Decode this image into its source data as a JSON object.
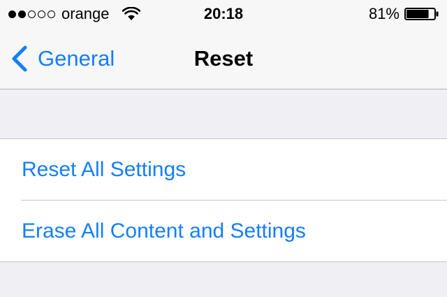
{
  "status_bar": {
    "signal_bars_filled": 2,
    "signal_bars_total": 5,
    "carrier": "orange",
    "time": "20:18",
    "battery_percent": "81%",
    "battery_level": 0.81
  },
  "nav": {
    "back_label": "General",
    "title": "Reset"
  },
  "reset_options": [
    {
      "label": "Reset All Settings"
    },
    {
      "label": "Erase All Content and Settings"
    }
  ],
  "colors": {
    "accent": "#157efb",
    "background": "#efeff4",
    "bar_background": "#f7f7f7",
    "separator": "#c8c7cc"
  },
  "icons": {
    "back": "chevron-left-icon",
    "wifi": "wifi-icon",
    "battery": "battery-icon",
    "signal": "signal-dots-icon"
  }
}
